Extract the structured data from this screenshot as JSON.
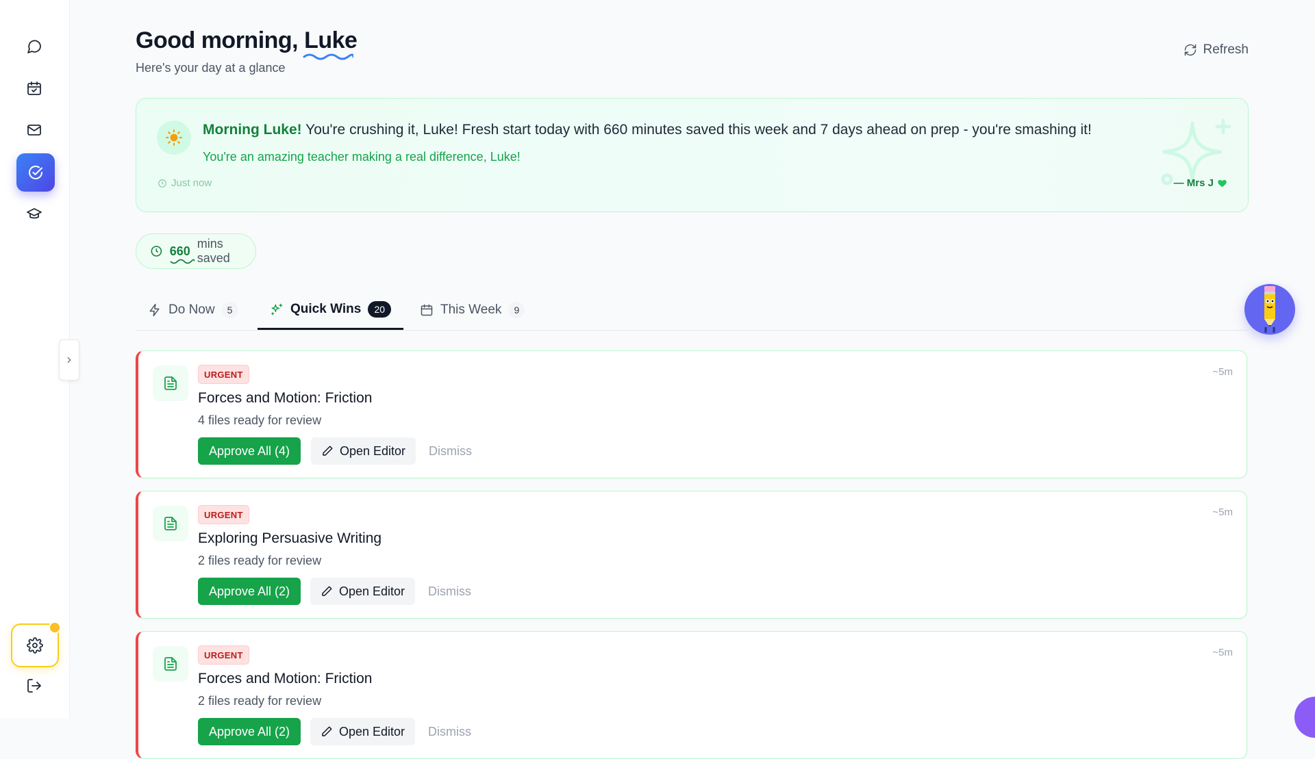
{
  "sidebar": {
    "items": [
      {
        "name": "chat-icon"
      },
      {
        "name": "calendar-check-icon"
      },
      {
        "name": "mail-icon"
      },
      {
        "name": "check-circle-icon",
        "active": true
      },
      {
        "name": "graduation-cap-icon"
      }
    ],
    "bottom": [
      {
        "name": "settings-gear-icon",
        "notification": true
      },
      {
        "name": "logout-icon"
      }
    ]
  },
  "header": {
    "greeting_prefix": "Good morning, ",
    "greeting_name": "Luke",
    "subtitle": "Here's your day at a glance",
    "refresh_label": "Refresh"
  },
  "banner": {
    "hello": "Morning Luke!",
    "message": " You're crushing it, Luke! Fresh start today with 660 minutes saved this week and 7 days ahead on prep - you're smashing it!",
    "encouragement": "You're an amazing teacher making a real difference, Luke!",
    "time": "Just now",
    "signature": "— Mrs J"
  },
  "stats": {
    "mins_value": "660",
    "mins_label": "mins saved"
  },
  "tabs": [
    {
      "label": "Do Now",
      "count": "5",
      "icon": "bolt-icon"
    },
    {
      "label": "Quick Wins",
      "count": "20",
      "icon": "sparkles-icon",
      "active": true
    },
    {
      "label": "This Week",
      "count": "9",
      "icon": "calendar-icon"
    }
  ],
  "cards": [
    {
      "badge": "URGENT",
      "title": "Forces and Motion: Friction",
      "subtitle": "4 files ready for review",
      "time": "~5m",
      "approve_label": "Approve All (4)",
      "editor_label": "Open Editor",
      "dismiss_label": "Dismiss"
    },
    {
      "badge": "URGENT",
      "title": "Exploring Persuasive Writing",
      "subtitle": "2 files ready for review",
      "time": "~5m",
      "approve_label": "Approve All (2)",
      "editor_label": "Open Editor",
      "dismiss_label": "Dismiss"
    },
    {
      "badge": "URGENT",
      "title": "Forces and Motion: Friction",
      "subtitle": "2 files ready for review",
      "time": "~5m",
      "approve_label": "Approve All (2)",
      "editor_label": "Open Editor",
      "dismiss_label": "Dismiss"
    }
  ],
  "colors": {
    "accent_green": "#16a34a",
    "urgent_red": "#ef4444",
    "active_nav": "#4f46e5",
    "settings_ring": "#facc15"
  }
}
